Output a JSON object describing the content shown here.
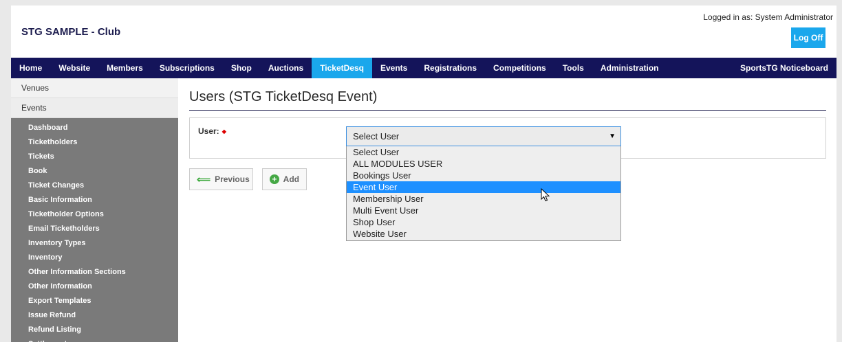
{
  "header": {
    "brand": "STG SAMPLE - Club",
    "logged_in": "Logged in as: System Administrator",
    "logoff_label": "Log Off"
  },
  "nav": {
    "items": [
      "Home",
      "Website",
      "Members",
      "Subscriptions",
      "Shop",
      "Auctions",
      "TicketDesq",
      "Events",
      "Registrations",
      "Competitions",
      "Tools",
      "Administration"
    ],
    "active": "TicketDesq",
    "right_item": "SportsTG Noticeboard"
  },
  "sidebar": {
    "top_items": [
      "Venues",
      "Events"
    ],
    "sub_items": [
      "Dashboard",
      "Ticketholders",
      "Tickets",
      "Book",
      "Ticket Changes",
      "Basic Information",
      "Ticketholder Options",
      "Email Ticketholders",
      "Inventory Types",
      "Inventory",
      "Other Information Sections",
      "Other Information",
      "Export Templates",
      "Issue Refund",
      "Refund Listing",
      "Settlements"
    ]
  },
  "main": {
    "title": "Users (STG TicketDesq Event)",
    "user_label": "User:",
    "select_value": "Select User",
    "options": [
      "Select User",
      "ALL MODULES USER",
      "Bookings User",
      "Event User",
      "Membership User",
      "Multi Event User",
      "Shop User",
      "Website User"
    ],
    "highlighted_option": "Event User",
    "previous_label": "Previous",
    "add_label": "Add"
  },
  "colors": {
    "nav_bg": "#14145a",
    "accent": "#1aa7ec",
    "sidebar_bg": "#7a7a7a",
    "highlight": "#1e90ff"
  }
}
